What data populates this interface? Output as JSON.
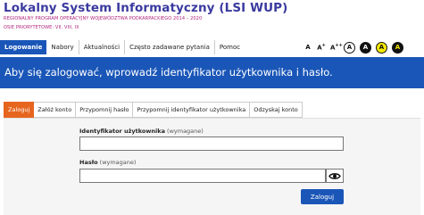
{
  "header": {
    "title": "Lokalny System Informatyczny (LSI WUP)",
    "subtitle": "REGIONALNY PROGRAM OPERACYJNY WOJEWÓDZTWA PODKARPACKIEGO 2014 – 2020",
    "priorities": "OSIE PRIORYTETOWE: VII, VIII, IX"
  },
  "nav": {
    "items": [
      "Logowanie",
      "Nabory",
      "Aktualności",
      "Często zadawane pytania",
      "Pomoc"
    ]
  },
  "accessibility": {
    "font_small": "A",
    "font_medium": "A",
    "font_medium_sup": "+",
    "font_large": "A",
    "font_large_sup": "++",
    "contrast_label": "A",
    "colors": {
      "yellow": "#f5e800",
      "black": "#111111"
    }
  },
  "banner": {
    "text": "Aby się zalogować, wprowadź identyfikator użytkownika i hasło."
  },
  "tabs": [
    "Zaloguj",
    "Załóż konto",
    "Przypomnij hasło",
    "Przypomnij identyfikator użytkownika",
    "Odzyskaj konto"
  ],
  "form": {
    "login_label": "Identyfikator użytkownika",
    "login_required": "(wymagane)",
    "login_value": "",
    "password_label": "Hasło",
    "password_required": "(wymagane)",
    "password_value": "",
    "submit_label": "Zaloguj"
  },
  "colors": {
    "accent": "#1a56b8",
    "active_tab": "#e6651f",
    "title": "#3a3aa0",
    "subtitle": "#b0237c"
  }
}
